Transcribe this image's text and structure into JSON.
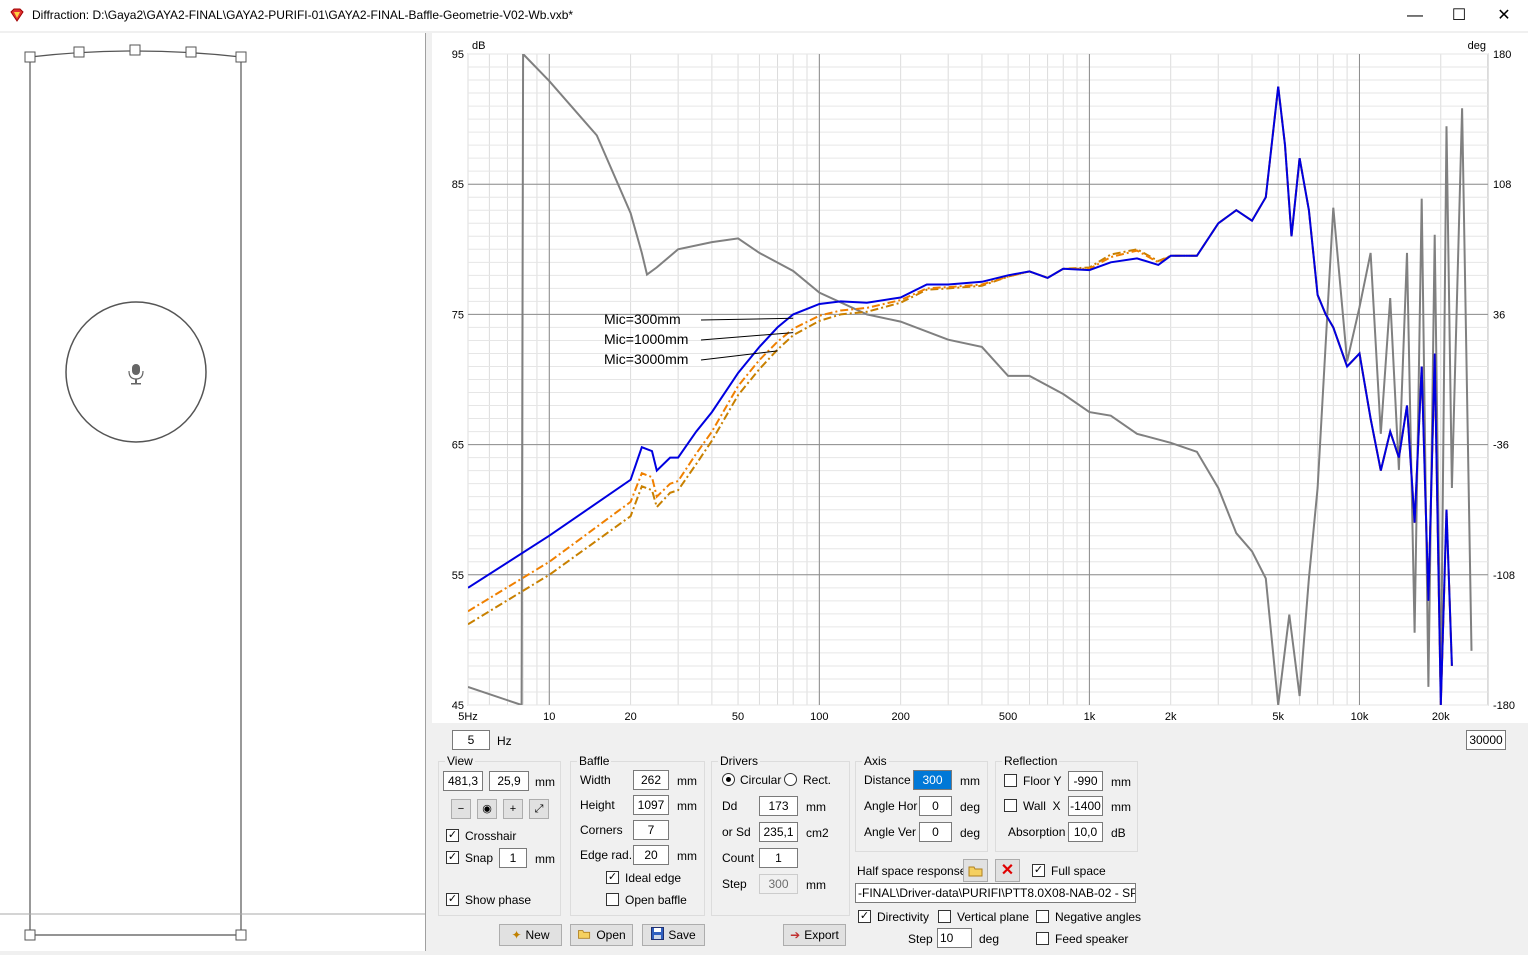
{
  "window": {
    "title": "Diffraction: D:\\Gaya2\\GAYA2-FINAL\\GAYA2-PURIFI-01\\GAYA2-FINAL-Baffle-Geometrie-V02-Wb.vxb*",
    "minimize": "—",
    "maximize": "☐",
    "close": "✕"
  },
  "chart_data": {
    "type": "line",
    "xscale": "log",
    "xlim": [
      5,
      30000
    ],
    "ylim_left": [
      45,
      95
    ],
    "ylim_right": [
      -180,
      180
    ],
    "ylabel_left": "dB",
    "ylabel_right": "deg",
    "x_ticks": [
      "5Hz",
      "10",
      "20",
      "50",
      "100",
      "200",
      "500",
      "1k",
      "2k",
      "5k",
      "10k",
      "20k"
    ],
    "x_tick_values": [
      5,
      10,
      20,
      50,
      100,
      200,
      500,
      1000,
      2000,
      5000,
      10000,
      20000
    ],
    "y_ticks_left": [
      "95",
      "85",
      "75",
      "65",
      "55",
      "45"
    ],
    "y_ticks_right": [
      "180",
      "108",
      "36",
      "-36",
      "-108",
      "-180"
    ],
    "grid": true,
    "annotations": [
      "Mic=300mm",
      "Mic=1000mm",
      "Mic=3000mm"
    ],
    "series": [
      {
        "color": "#0000e0",
        "style": "solid",
        "x": [
          5,
          10,
          20,
          22,
          24,
          25,
          28,
          30,
          35,
          40,
          50,
          60,
          70,
          80,
          100,
          120,
          150,
          200,
          250,
          300,
          400,
          500,
          600,
          700,
          800,
          1000,
          1200,
          1500,
          1800,
          2000,
          2500,
          3000,
          3500,
          4000,
          4500,
          5000,
          5300,
          5600,
          6000,
          6500,
          7000,
          7500,
          8000,
          9000,
          10000,
          11000,
          12000,
          13000,
          14000,
          15000,
          16000,
          17000,
          18000,
          19000,
          20000,
          21000,
          22000
        ],
        "y": [
          54,
          58,
          62.3,
          64.8,
          64.5,
          63,
          64,
          64,
          66,
          67.5,
          70.5,
          72.5,
          74,
          75,
          75.8,
          76,
          75.9,
          76.3,
          77.3,
          77.3,
          77.5,
          78,
          78.3,
          77.8,
          78.5,
          78.4,
          79,
          79.3,
          78.8,
          79.5,
          79.5,
          82,
          83,
          82.2,
          84,
          92.5,
          88,
          81,
          87,
          83,
          76.5,
          75,
          74,
          71,
          72,
          67,
          63,
          66,
          64,
          68,
          59,
          71,
          53,
          72,
          45,
          60,
          48
        ]
      },
      {
        "color": "#f08000",
        "style": "dashdot",
        "x": [
          5,
          10,
          20,
          22,
          24,
          25,
          28,
          30,
          35,
          40,
          50,
          60,
          70,
          80,
          100,
          120,
          150,
          200,
          250,
          300,
          400,
          500,
          600,
          700,
          800,
          1000,
          1200,
          1500,
          1800,
          2000,
          2500,
          3000,
          3500,
          4000,
          4500,
          5000,
          5300,
          5600,
          6000,
          6500,
          7000,
          7500,
          8000,
          9000,
          10000,
          11000,
          12000,
          13000,
          14000,
          15000,
          16000,
          17000,
          18000,
          19000,
          20000,
          21000,
          22000
        ],
        "y": [
          52.2,
          56,
          60.6,
          62.8,
          62.5,
          61,
          62,
          62.2,
          64.3,
          66,
          69.5,
          71.5,
          72.9,
          73.9,
          74.9,
          75.3,
          75.5,
          76.1,
          77,
          77.1,
          77.3,
          77.9,
          78.3,
          77.8,
          78.5,
          78.5,
          79.4,
          79.9,
          79,
          79.5,
          79.5,
          82,
          83,
          82.2,
          84,
          92.5,
          88,
          81,
          87,
          83,
          76.5,
          75,
          74,
          71,
          72,
          67,
          63,
          66,
          64,
          68,
          59,
          71,
          53,
          72,
          45,
          60,
          48
        ]
      },
      {
        "color": "#c88000",
        "style": "dashdot",
        "x": [
          5,
          10,
          20,
          22,
          24,
          25,
          28,
          30,
          35,
          40,
          50,
          60,
          70,
          80,
          100,
          120,
          150,
          200,
          250,
          300,
          400,
          500,
          600,
          700,
          800,
          1000,
          1200,
          1500,
          1800,
          2000,
          2500,
          3000,
          3500,
          4000,
          4500,
          5000,
          5300,
          5600,
          6000,
          6500,
          7000,
          7500,
          8000,
          9000,
          10000,
          11000,
          12000,
          13000,
          14000,
          15000,
          16000,
          17000,
          18000,
          19000,
          20000,
          21000,
          22000
        ],
        "y": [
          51.2,
          55,
          59.5,
          61.8,
          61.5,
          60.2,
          61.3,
          61.5,
          63.5,
          65.3,
          68.8,
          70.8,
          72.3,
          73.4,
          74.5,
          75,
          75.2,
          75.9,
          76.9,
          77,
          77.2,
          77.9,
          78.3,
          77.8,
          78.5,
          78.6,
          79.6,
          80,
          79.1,
          79.5,
          79.5,
          82,
          83,
          82.2,
          84,
          92.5,
          88,
          81,
          87,
          83,
          76.5,
          75,
          74,
          71,
          72,
          67,
          63,
          66,
          64,
          68,
          59,
          71,
          53,
          72,
          45,
          60,
          48
        ]
      },
      {
        "color": "#808080",
        "style": "solid",
        "axis": "right",
        "x": [
          5,
          7.9,
          8,
          10,
          15,
          20,
          22,
          23,
          25,
          30,
          40,
          50,
          60,
          80,
          100,
          150,
          200,
          300,
          400,
          500,
          600,
          800,
          1000,
          1200,
          1500,
          2000,
          2500,
          3000,
          3500,
          4000,
          4500,
          5000,
          5500,
          6000,
          6500,
          7000,
          8000,
          9000,
          10000,
          11000,
          12000,
          13000,
          14000,
          15000,
          16000,
          17000,
          18000,
          19000,
          20000,
          21000,
          22000,
          24000,
          26000
        ],
        "y": [
          -170,
          -180,
          180,
          165,
          135,
          92,
          70,
          58,
          62,
          72,
          76,
          78,
          70,
          60,
          48,
          36,
          32,
          22,
          18,
          2,
          2,
          -8,
          -18,
          -20,
          -30,
          -35,
          -40,
          -60,
          -85,
          -95,
          -110,
          -180,
          -130,
          -175,
          -110,
          -60,
          95,
          10,
          40,
          70,
          -30,
          45,
          -50,
          70,
          -140,
          100,
          -170,
          80,
          -175,
          140,
          -60,
          150,
          -150
        ]
      }
    ]
  },
  "freq_min": "5",
  "freq_unit": "Hz",
  "freq_max": "30000",
  "view": {
    "legend": "View",
    "x": "481,3",
    "y": "25,9",
    "unit": "mm",
    "crosshair_label": "Crosshair",
    "snap_label": "Snap",
    "snap_value": "1",
    "snap_unit": "mm",
    "show_phase_label": "Show phase"
  },
  "baffle": {
    "legend": "Baffle",
    "width_label": "Width",
    "width_value": "262",
    "width_unit": "mm",
    "height_label": "Height",
    "height_value": "1097",
    "height_unit": "mm",
    "corners_label": "Corners",
    "corners_value": "7",
    "edge_label": "Edge rad.",
    "edge_value": "20",
    "edge_unit": "mm",
    "ideal_edge_label": "Ideal edge",
    "open_baffle_label": "Open baffle"
  },
  "drivers": {
    "legend": "Drivers",
    "circular_label": "Circular",
    "rect_label": "Rect.",
    "dd_label": "Dd",
    "dd_value": "173",
    "dd_unit": "mm",
    "sd_label": "or Sd",
    "sd_value": "235,1",
    "sd_unit": "cm2",
    "count_label": "Count",
    "count_value": "1",
    "step_label": "Step",
    "step_value": "300",
    "step_unit": "mm"
  },
  "axis": {
    "legend": "Axis",
    "distance_label": "Distance",
    "distance_value": "300",
    "distance_unit": "mm",
    "angle_hor_label": "Angle Hor",
    "angle_hor_value": "0",
    "angle_hor_unit": "deg",
    "angle_ver_label": "Angle Ver",
    "angle_ver_value": "0",
    "angle_ver_unit": "deg"
  },
  "reflection": {
    "legend": "Reflection",
    "floor_label": "Floor Y",
    "floor_value": "-990",
    "floor_unit": "mm",
    "wall_label": "Wall  X",
    "wall_value": "-1400",
    "wall_unit": "mm",
    "absorption_label": "Absorption",
    "absorption_value": "10,0",
    "absorption_unit": "dB"
  },
  "half_space": {
    "label": "Half space response",
    "full_space_label": "Full space",
    "file_path": "-FINAL\\Driver-data\\PURIFI\\PTT8.0X08-NAB-02 - SPL.txt"
  },
  "directivity": {
    "directivity_label": "Directivity",
    "vertical_plane_label": "Vertical plane",
    "negative_angles_label": "Negative angles",
    "step_label": "Step",
    "step_value": "10",
    "step_unit": "deg",
    "feed_speaker_label": "Feed speaker"
  },
  "buttons": {
    "new": "New",
    "open": "Open",
    "save": "Save",
    "export": "Export"
  },
  "colors": {
    "accent_selection": "#0078d7",
    "close_icon_red": "#e00000"
  }
}
